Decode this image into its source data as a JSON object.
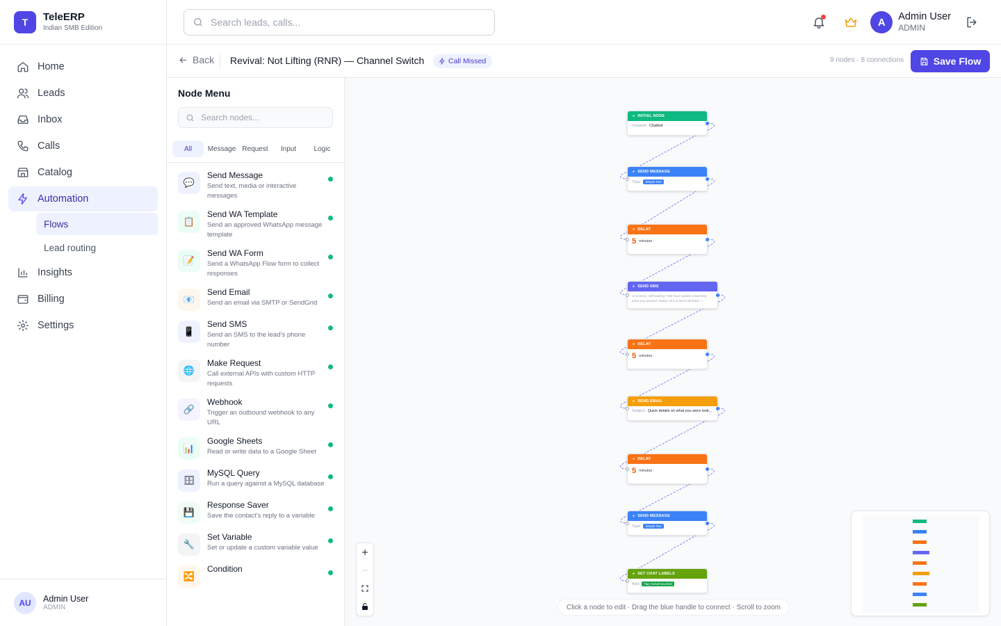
{
  "brand": {
    "initial": "T",
    "name": "TeleERP",
    "subtitle": "Indian SMB Edition"
  },
  "sidebar": {
    "items": [
      {
        "label": "Home",
        "icon": "home-icon"
      },
      {
        "label": "Leads",
        "icon": "users-icon"
      },
      {
        "label": "Inbox",
        "icon": "inbox-icon"
      },
      {
        "label": "Calls",
        "icon": "phone-icon"
      },
      {
        "label": "Catalog",
        "icon": "store-icon"
      },
      {
        "label": "Automation",
        "icon": "bolt-icon",
        "active": true
      },
      {
        "label": "Insights",
        "icon": "bar-chart-icon"
      },
      {
        "label": "Billing",
        "icon": "wallet-icon"
      },
      {
        "label": "Settings",
        "icon": "gear-icon"
      }
    ],
    "subitems": [
      {
        "label": "Flows",
        "active": true
      },
      {
        "label": "Lead routing"
      }
    ],
    "footer": {
      "initials": "AU",
      "name": "Admin User",
      "role": "ADMIN"
    }
  },
  "header": {
    "search_placeholder": "Search leads, calls...",
    "user": {
      "initial": "A",
      "name": "Admin User",
      "role": "ADMIN"
    }
  },
  "subheader": {
    "back_label": "Back",
    "flow_title": "Revival: Not Lifting (RNR) — Channel Switch",
    "trigger_badge": "Call Missed",
    "stats": "9 nodes · 8 connections",
    "save_label": "Save Flow"
  },
  "node_menu": {
    "title": "Node Menu",
    "search_placeholder": "Search nodes...",
    "tabs": [
      "All",
      "Message",
      "Request",
      "Input",
      "Logic"
    ],
    "items": [
      {
        "name": "Send Message",
        "desc": "Send text, media or interactive messages",
        "glyph": "💬",
        "bg": "#eef2ff"
      },
      {
        "name": "Send WA Template",
        "desc": "Send an approved WhatsApp message template",
        "glyph": "📋",
        "bg": "#ecfdf5"
      },
      {
        "name": "Send WA Form",
        "desc": "Send a WhatsApp Flow form to collect responses",
        "glyph": "📝",
        "bg": "#ecfdf5"
      },
      {
        "name": "Send Email",
        "desc": "Send an email via SMTP or SendGrid",
        "glyph": "📧",
        "bg": "#fff7ed"
      },
      {
        "name": "Send SMS",
        "desc": "Send an SMS to the lead's phone number",
        "glyph": "📱",
        "bg": "#eef2ff"
      },
      {
        "name": "Make Request",
        "desc": "Call external APIs with custom HTTP requests",
        "glyph": "🌐",
        "bg": "#f3f4f6"
      },
      {
        "name": "Webhook",
        "desc": "Trigger an outbound webhook to any URL",
        "glyph": "🔗",
        "bg": "#f5f3ff"
      },
      {
        "name": "Google Sheets",
        "desc": "Read or write data to a Google Sheet",
        "glyph": "📊",
        "bg": "#ecfdf5"
      },
      {
        "name": "MySQL Query",
        "desc": "Run a query against a MySQL database",
        "glyph": "🗄",
        "bg": "#eef2ff"
      },
      {
        "name": "Response Saver",
        "desc": "Save the contact's reply to a variable",
        "glyph": "💾",
        "bg": "#f0fdf4"
      },
      {
        "name": "Set Variable",
        "desc": "Set or update a custom variable value",
        "glyph": "🔧",
        "bg": "#f3f4f6"
      },
      {
        "name": "Condition",
        "desc": "",
        "glyph": "🔀",
        "bg": "#fff7ed"
      }
    ]
  },
  "canvas": {
    "nodes": [
      {
        "title": "INITIAL NODE",
        "color": "#10b981",
        "label": "Channel:",
        "value": "Chatbot",
        "kind": "kv"
      },
      {
        "title": "SEND MESSAGE",
        "color": "#3b82f6",
        "label": "Type:",
        "value": "Simple Text",
        "kind": "pill"
      },
      {
        "title": "DELAY",
        "color": "#f97316",
        "amount": "5",
        "unit": "minutes",
        "kind": "delay"
      },
      {
        "title": "SEND SMS",
        "color": "#6366f1",
        "value": "Hi {name}, still looking? We have options matching what you wanted. Reply YES & we'll call back — ",
        "kind": "text"
      },
      {
        "title": "DELAY",
        "color": "#f97316",
        "amount": "5",
        "unit": "minutes",
        "kind": "delay"
      },
      {
        "title": "SEND EMAIL",
        "color": "#f59e0b",
        "label": "Subject:",
        "value": "Quick details on what you were look...",
        "kind": "kv"
      },
      {
        "title": "DELAY",
        "color": "#f97316",
        "amount": "5",
        "unit": "minutes",
        "kind": "delay"
      },
      {
        "title": "SEND MESSAGE",
        "color": "#3b82f6",
        "label": "Type:",
        "value": "Simple Text",
        "kind": "pill"
      },
      {
        "title": "SET CHAT LABELS",
        "color": "#65a30d",
        "label": "Add:",
        "value": "Tag: revival-touched",
        "kind": "pillgreen"
      }
    ],
    "hint": "Click a node to edit · Drag the blue handle to connect · Scroll to zoom"
  }
}
